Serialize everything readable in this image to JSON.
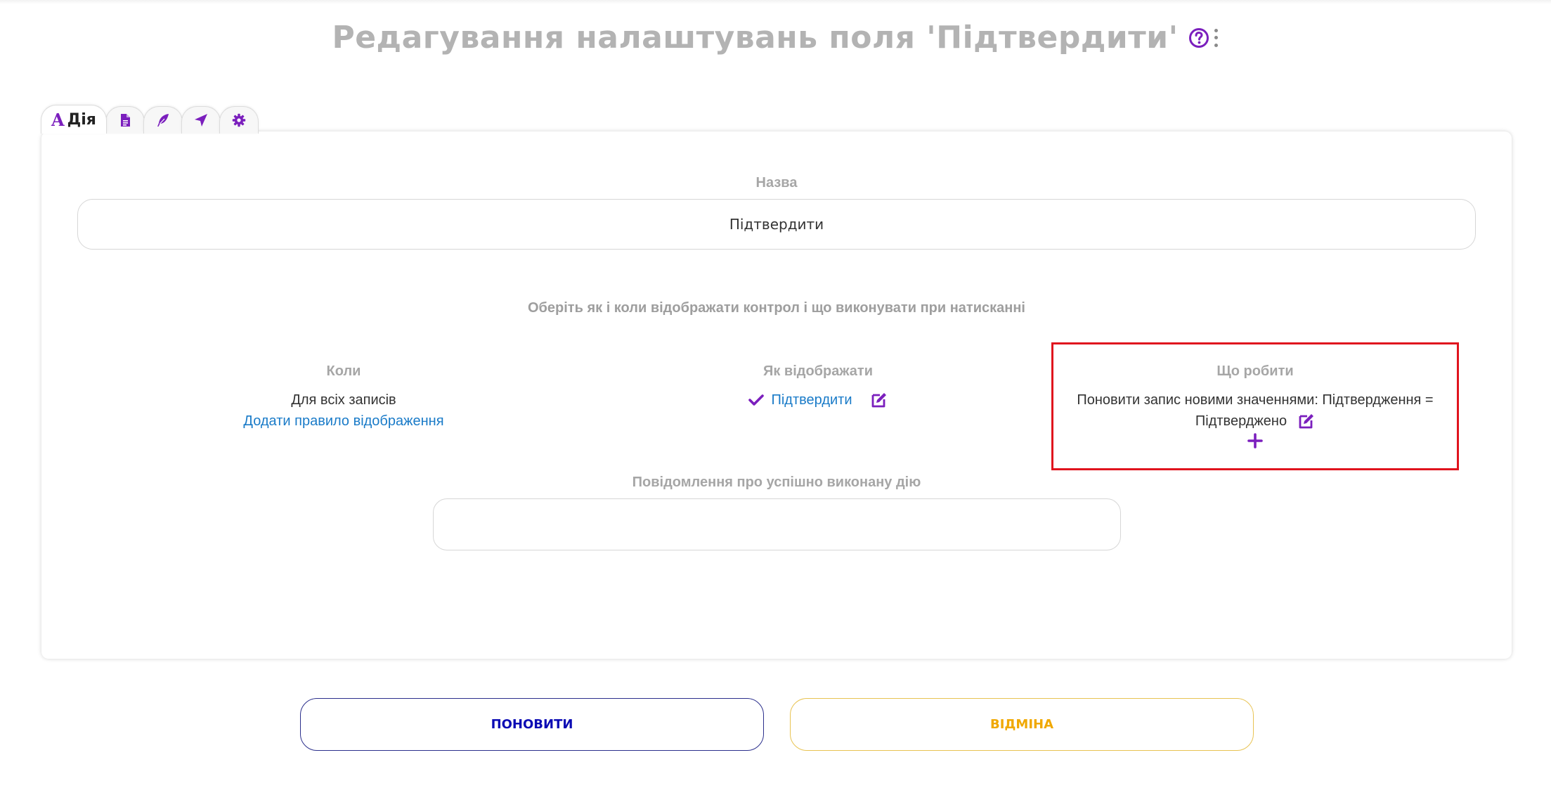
{
  "page": {
    "title": "Редагування налаштувань поля 'Підтвердити'"
  },
  "tabs": {
    "action": {
      "letter": "A",
      "label": "Дія"
    },
    "icons": [
      "document-icon",
      "feather-icon",
      "location-arrow-icon",
      "gear-icon"
    ]
  },
  "form": {
    "name_label": "Назва",
    "name_value": "Підтвердити",
    "hint": "Оберіть як і коли відображати контрол і що виконувати при натисканні",
    "when": {
      "title": "Коли",
      "value": "Для всіх записів",
      "add_rule_link": "Додати правило відображення"
    },
    "how": {
      "title": "Як відображати",
      "button_label": "Підтвердити"
    },
    "what": {
      "title": "Що робити",
      "action_line1": "Поновити запис новими значеннями: Підтвердження =",
      "action_line2": "Підтверджено"
    },
    "success_label": "Повідомлення про успішно виконану дію",
    "success_value": ""
  },
  "buttons": {
    "update": "ПОНОВИТИ",
    "cancel": "ВІДМІНА"
  },
  "colors": {
    "accent": "#7b1fbd",
    "link": "#1a7bc8",
    "highlight": "#e0141e",
    "update_text": "#0b0bb4",
    "cancel_text": "#f0a800"
  }
}
